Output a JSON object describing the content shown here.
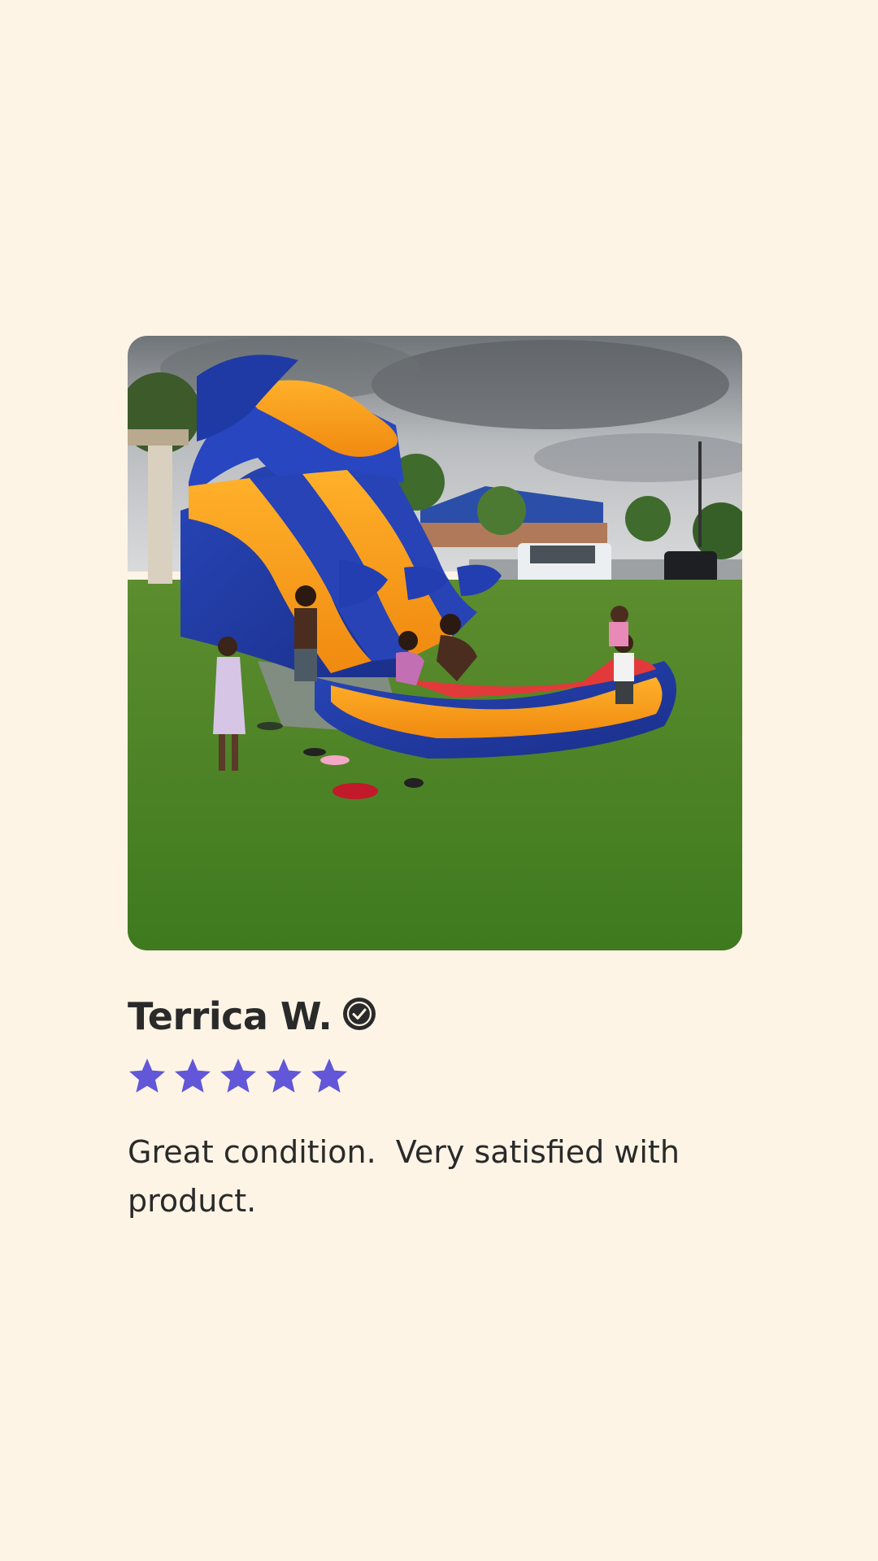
{
  "review": {
    "photo_icon": "customer-photo",
    "reviewer_name": "Terrica W.",
    "verified_icon": "verified-check-icon",
    "rating": {
      "value": 5,
      "max": 5,
      "star_icon": "star-icon",
      "star_color": "#6157d8"
    },
    "body": "Great condition.  Very satisfied with product."
  },
  "colors": {
    "background": "#fdf4e5",
    "text": "#2a2a2a",
    "accent": "#6157d8"
  }
}
